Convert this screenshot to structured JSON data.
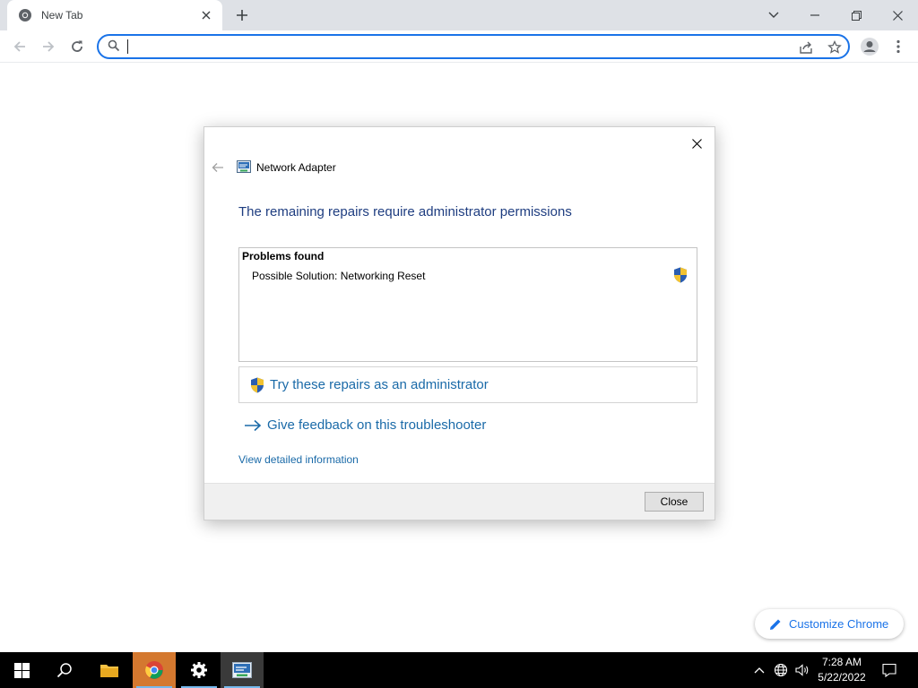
{
  "browser": {
    "tab": {
      "title": "New Tab",
      "favicon": "chrome-icon"
    },
    "omnibox": {
      "value": "",
      "placeholder": ""
    },
    "window_controls": [
      "minimize",
      "restore",
      "close"
    ]
  },
  "dialog": {
    "app_title": "Network Adapter",
    "heading": "The remaining repairs require administrator permissions",
    "problems": {
      "title": "Problems found",
      "items": [
        "Possible Solution: Networking Reset"
      ]
    },
    "admin_button_label": "Try these repairs as an administrator",
    "feedback_link": "Give feedback on this troubleshooter",
    "details_link": "View detailed information",
    "close_button": "Close"
  },
  "customize_chrome": {
    "label": "Customize Chrome"
  },
  "taskbar": {
    "apps": [
      "start-icon",
      "search-icon",
      "file-explorer-icon",
      "chrome-icon",
      "settings-icon",
      "network-troubleshooter-icon"
    ],
    "clock": {
      "time": "7:28 AM",
      "date": "5/22/2022"
    }
  },
  "colors": {
    "accent": "#1a73e8",
    "dialog_heading": "#1e3d80",
    "dialog_link": "#1a6aa8",
    "taskbar": "#000000"
  }
}
